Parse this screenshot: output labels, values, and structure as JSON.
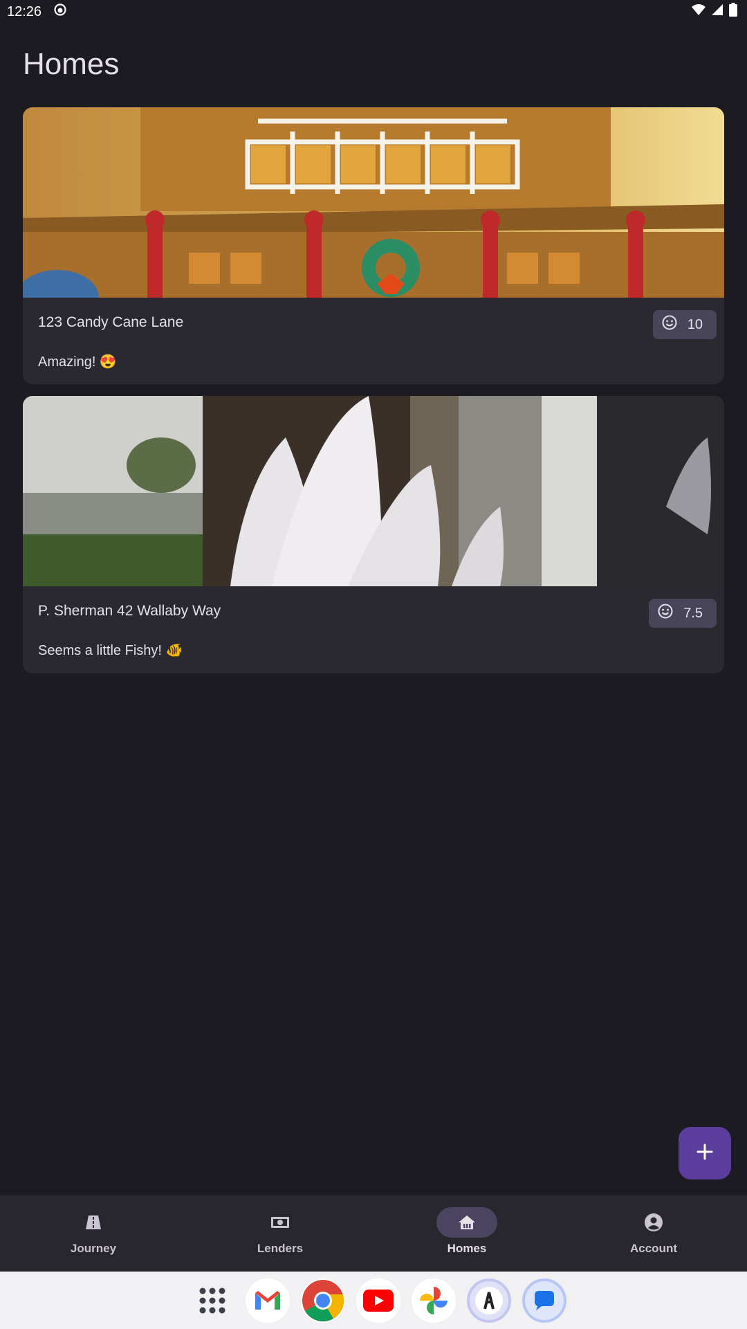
{
  "status_bar": {
    "time": "12:26",
    "icons": [
      "app-notification-icon",
      "wifi-icon",
      "signal-icon",
      "battery-icon"
    ]
  },
  "page": {
    "title": "Homes"
  },
  "homes": [
    {
      "address": "123 Candy Cane Lane",
      "description": "Amazing! 😍",
      "rating": "10",
      "rating_icon": "smiley-icon",
      "image": "gingerbread-house-photo"
    },
    {
      "address": "P. Sherman 42 Wallaby Way",
      "description": "Seems a little Fishy! 🐠",
      "rating": "7.5",
      "rating_icon": "smiley-icon",
      "image": "opera-house-decal-photo"
    }
  ],
  "fab": {
    "icon": "plus-icon"
  },
  "bottom_nav": {
    "items": [
      {
        "label": "Journey",
        "icon": "road-icon",
        "active": false
      },
      {
        "label": "Lenders",
        "icon": "money-icon",
        "active": false
      },
      {
        "label": "Homes",
        "icon": "home-icon",
        "active": true
      },
      {
        "label": "Account",
        "icon": "account-icon",
        "active": false
      }
    ]
  },
  "dock": {
    "apps": [
      "app-drawer-icon",
      "gmail-icon",
      "chrome-icon",
      "youtube-icon",
      "photos-icon",
      "app-icon",
      "messages-icon"
    ]
  },
  "colors": {
    "background": "#1c1b21",
    "card": "#2a2930",
    "chip": "#48455a",
    "fab": "#5b3d9e",
    "nav": "#28272e",
    "nav_active_pill": "#4a4460"
  }
}
